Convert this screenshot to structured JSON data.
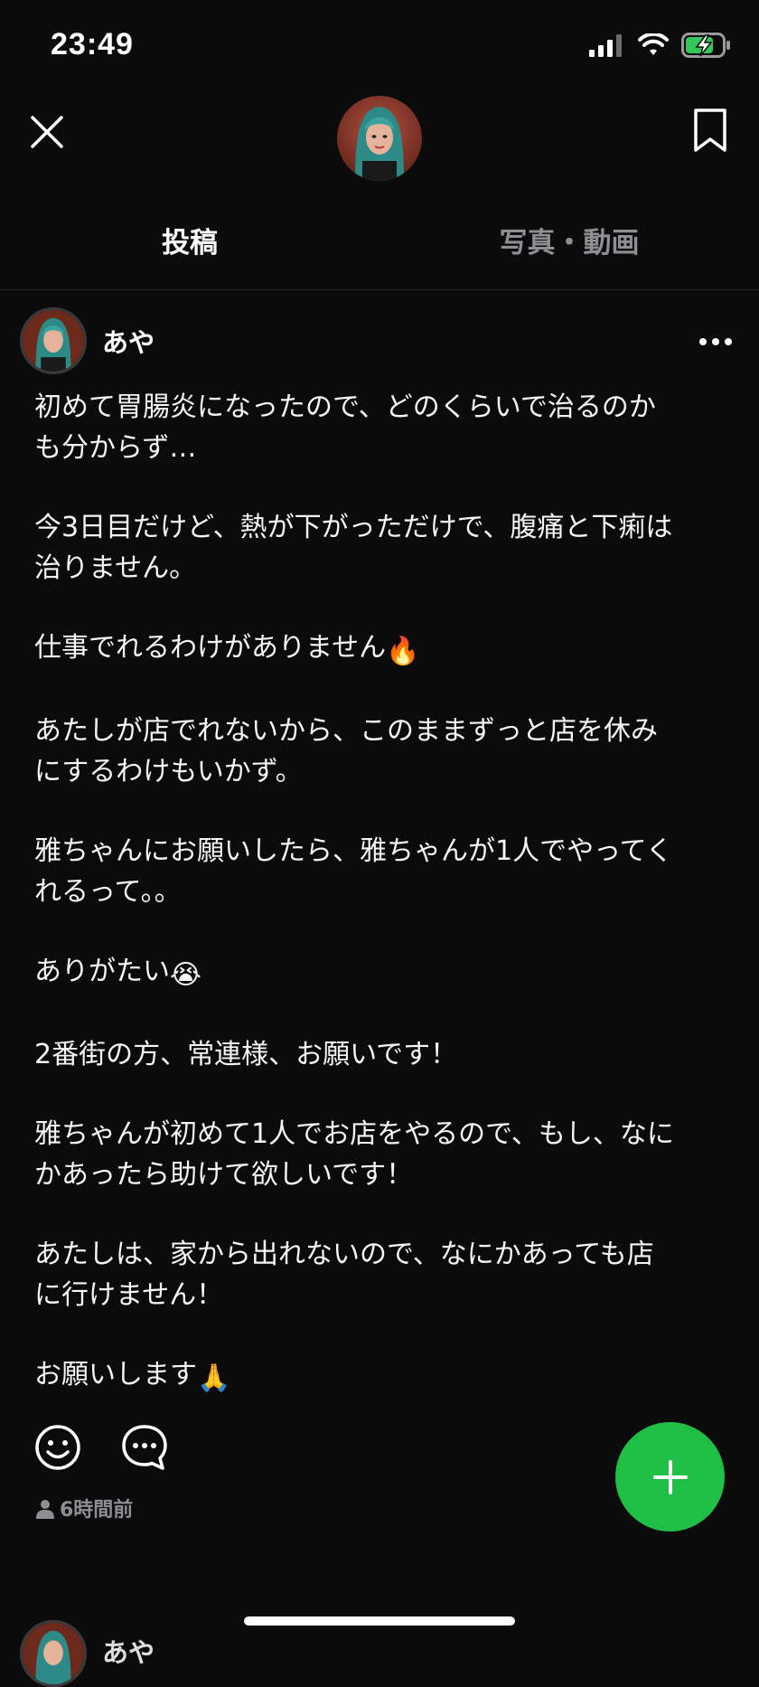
{
  "status_bar": {
    "time": "23:49"
  },
  "header": {
    "close_icon": "close-icon",
    "bookmark_icon": "bookmark-icon"
  },
  "tabs": [
    {
      "label": "投稿",
      "active": true
    },
    {
      "label": "写真・動画",
      "active": false
    }
  ],
  "post": {
    "author": "あや",
    "paragraphs": [
      "初めて胃腸炎になったので、どのくらいで治るのか\nも分からず…",
      "今3日目だけど、熱が下がっただけで、腹痛と下痢は\n治りません。",
      "仕事でれるわけがありません",
      "あたしが店でれないから、このままずっと店を休み\nにするわけもいかず。",
      "雅ちゃんにお願いしたら、雅ちゃんが1人でやってく\nれるって。。",
      "ありがたい",
      "2番街の方、常連様、お願いです！",
      "雅ちゃんが初めて1人でお店をやるので、もし、なに\nかあったら助けて欲しいです！",
      "あたしは、家から出れないので、なにかあっても店\nに行けません！",
      "お願いします"
    ],
    "emoji": {
      "fire": "🔥",
      "crying": "😭",
      "pray": "🙏"
    },
    "timestamp": "6時間前"
  },
  "next_post": {
    "author": "あや"
  },
  "colors": {
    "background": "#0b0b0c",
    "fab": "#1fbf46",
    "muted": "#8e8e93",
    "battery": "#34c759"
  }
}
